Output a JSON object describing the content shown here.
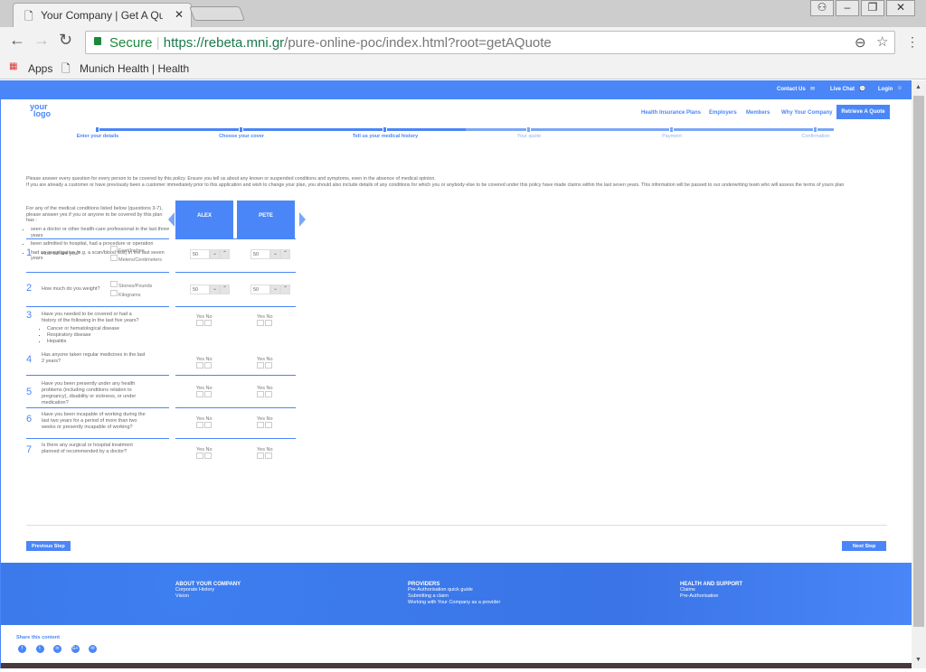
{
  "browser": {
    "tab_title": "Your Company | Get A Quote",
    "secure_label": "Secure",
    "url_host": "https://rebeta.mni.gr",
    "url_path": "/pure-online-poc/index.html?root=getAQuote",
    "bookmarks": [
      {
        "label": "Apps",
        "icon": "apps-grid-icon"
      },
      {
        "label": "Munich Health | Health",
        "icon": "page-icon"
      }
    ]
  },
  "topbar": {
    "contact": "Contact Us",
    "chat": "Live Chat",
    "login": "Login"
  },
  "logo": {
    "line1": "your",
    "line2": "logo"
  },
  "nav": [
    "Health Insurance Plans",
    "Employers",
    "Members",
    "Why Your Company"
  ],
  "nav_cta": "Retrieve A Quote",
  "steps": [
    {
      "label": "Enter your details",
      "done": true
    },
    {
      "label": "Choose your cover",
      "done": true
    },
    {
      "label": "Tell us your medical history",
      "done": true
    },
    {
      "label": "Your quote",
      "done": false
    },
    {
      "label": "Payment",
      "done": false
    },
    {
      "label": "Confirmation",
      "done": false
    }
  ],
  "intro": [
    "Please answer every question for every person to be covered by this policy. Ensure you tell us about any known or suspended conditions and symptoms, even in the absence of medical opinion.",
    "If you are already a customer or have previously been a customer immediately prior to this application and wish to change your plan, you should also include details of any conditions for which you or anybody else to be covered under this policy have made claims within the last seven years. This information will be passed to our underwriting team who will assess the terms of yours plan"
  ],
  "lead": "For any of the medical conditions listed below (questions 3-7), please answer yes if you or anyone to be covered by this plan has :",
  "conditions": [
    "seen a doctor or other health-care professional in the last three years",
    "been admitted to hospital, had a procedure or operation",
    "had an investigation (e.g. a scan/blood test) in the last seven years"
  ],
  "people": [
    "ALEX",
    "PETE"
  ],
  "yes": "Yes",
  "no": "No",
  "q_height": {
    "num": "1",
    "text": "How tall are you?",
    "units": [
      "Feet/Inches",
      "Meters/Centimeters"
    ],
    "values": [
      "50",
      "50"
    ]
  },
  "q_weight": {
    "num": "2",
    "text": "How much do you weight?",
    "units": [
      "Stones/Pounds",
      "Kilograms"
    ],
    "values": [
      "50",
      "50"
    ]
  },
  "questions": [
    {
      "num": "3",
      "text": "Have you needed to be covered or had a history of the following in the last five years?",
      "items": [
        "Cancer or hematological disease",
        "Respiratory disease",
        "Hepatitis"
      ]
    },
    {
      "num": "4",
      "text": "Has anyone taken regular medicines in the last 2 years?"
    },
    {
      "num": "5",
      "text": "Have you been presently under any health problems (including conditions relation to pregnancy), disability or sickness, or under medication?"
    },
    {
      "num": "6",
      "text": "Have you been incapable of working during the last two years for a period of more than two weeks or presently incapable of working?"
    },
    {
      "num": "7",
      "text": "Is there any surgical or hospital treatment planned of recommended by a doctor?"
    }
  ],
  "prev": "Previous Step",
  "next": "Next Step",
  "footer": [
    {
      "title": "ABOUT YOUR COMPANY",
      "links": [
        "Corporate History",
        "Vision"
      ]
    },
    {
      "title": "PROVIDERS",
      "links": [
        "Pre-Authorisation quick guide",
        "Submitting a claim",
        "Working with Your Company as a provider"
      ]
    },
    {
      "title": "HEALTH AND SUPPORT",
      "links": [
        "Claims",
        "Pre-Authorisation"
      ]
    }
  ],
  "share": "Share this content",
  "social": [
    "facebook-icon",
    "twitter-icon",
    "linkedin-icon",
    "google-plus-icon",
    "email-icon"
  ],
  "colors": {
    "accent": "#4a86f7",
    "dark": "#48393f"
  }
}
